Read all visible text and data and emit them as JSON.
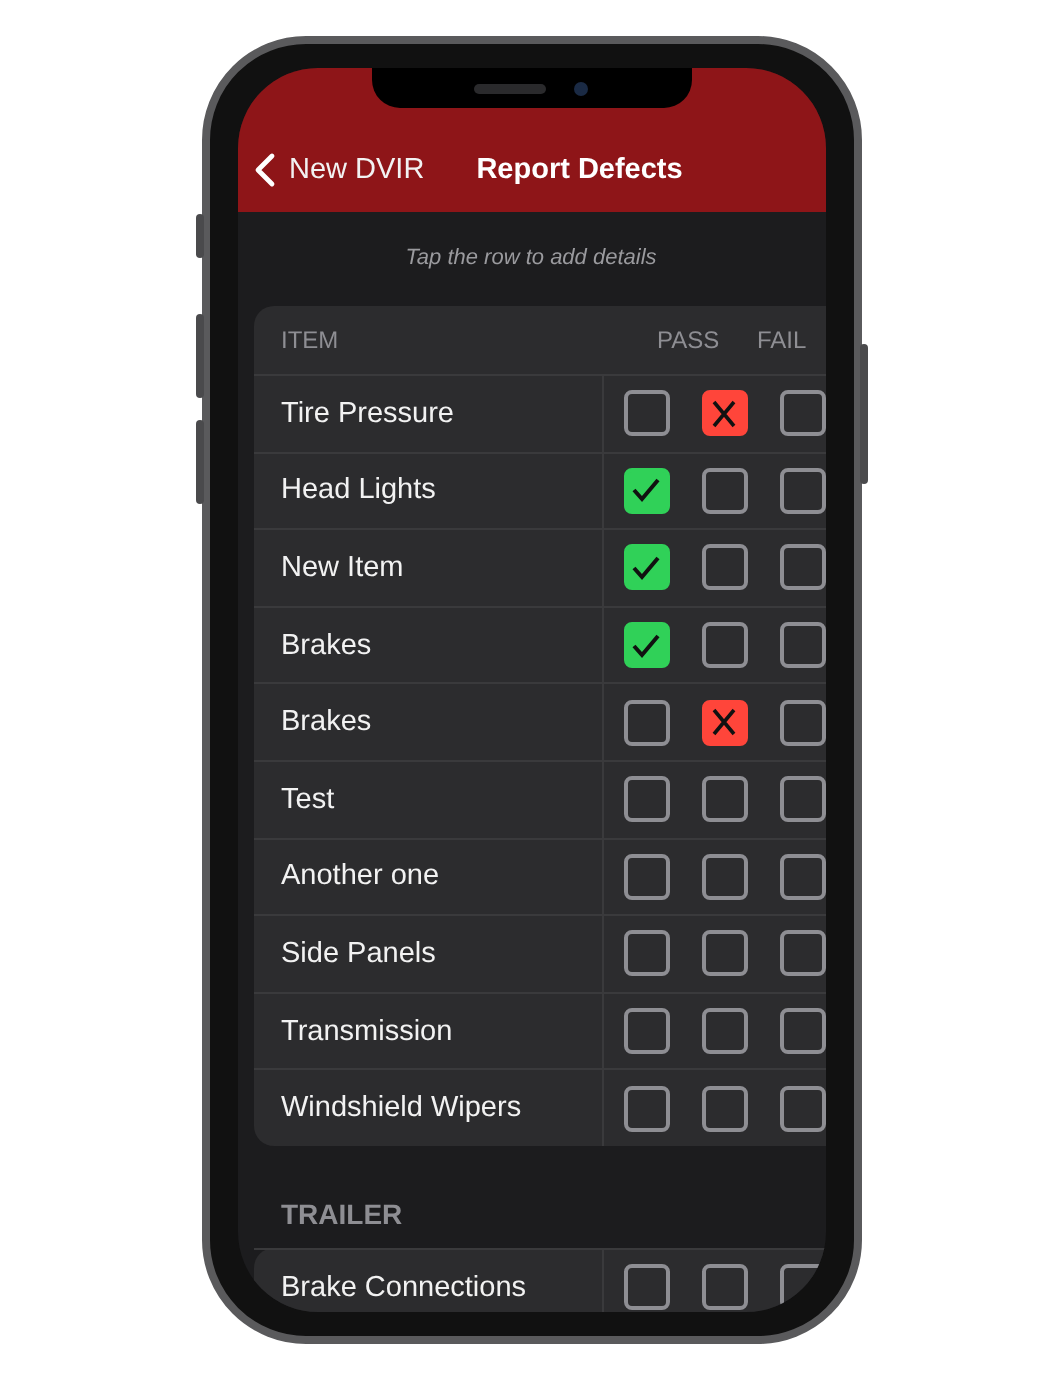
{
  "nav_bar": {
    "back_label": "New DVIR",
    "title": "Report Defects"
  },
  "hint": "Tap the row to add details",
  "table": {
    "columns": [
      "ITEM",
      "PASS",
      "FAIL"
    ],
    "rows": [
      {
        "name": "Tire Pressure",
        "pass": false,
        "fail": true,
        "column_3": false
      },
      {
        "name": "Head Lights",
        "pass": true,
        "fail": false,
        "column_3": false
      },
      {
        "name": "New Item",
        "pass": true,
        "fail": false,
        "column_3": false
      },
      {
        "name": "Brakes",
        "pass": true,
        "fail": false,
        "column_3": false
      },
      {
        "name": "Brakes",
        "pass": false,
        "fail": true,
        "column_3": false
      },
      {
        "name": "Test",
        "pass": false,
        "fail": false,
        "column_3": false
      },
      {
        "name": "Another one",
        "pass": false,
        "fail": false,
        "column_3": false
      },
      {
        "name": "Side Panels",
        "pass": false,
        "fail": false,
        "column_3": false
      },
      {
        "name": "Transmission",
        "pass": false,
        "fail": false,
        "column_3": false
      },
      {
        "name": "Windshield Wipers",
        "pass": false,
        "fail": false,
        "column_3": false
      }
    ]
  },
  "trailer": {
    "title": "TRAILER",
    "rows": [
      {
        "name": "Brake Connections",
        "pass": false,
        "fail": false,
        "column_3": false
      }
    ]
  }
}
